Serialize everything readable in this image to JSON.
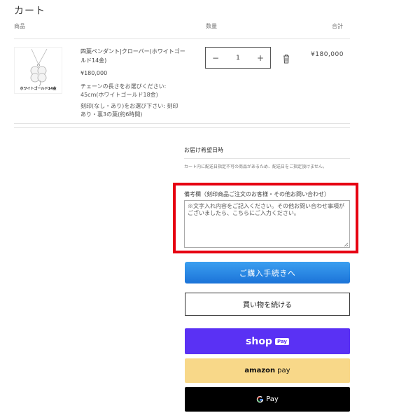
{
  "cart": {
    "title": "カート",
    "columns": {
      "product": "商品",
      "quantity": "数量",
      "total": "合計"
    },
    "item": {
      "thumb_caption": "ホワイトゴールド14金",
      "name": "四葉ペンダント|クローバー(ホワイトゴールド14金)",
      "price": "¥180,000",
      "option1": "チェーンの長さをお選びください: 45cm(ホワイトゴールド18金)",
      "option2": "刻印(なし・あり)をお選び下さい: 刻印あり・裏3の葉(約6時間)",
      "quantity": "1",
      "minus": "−",
      "plus": "+",
      "line_total": "¥180,000"
    }
  },
  "delivery": {
    "label": "お届け希望日時",
    "note": "カート内に配送日指定不可の商品があるため、配送日をご指定頂けません。"
  },
  "memo": {
    "label": "備考欄（刻印商品ご注文のお客様・その他お問い合わせ）",
    "value": "※文字入れ内容をご記入ください。その他お問い合わせ事項がございましたら、こちらにご入力ください。"
  },
  "buttons": {
    "checkout": "ご購入手続きへ",
    "continue": "買い物を続ける",
    "shop_pay": {
      "word": "shop",
      "badge": "Pay"
    },
    "amazon_pay": {
      "word": "amazon",
      "suffix": "pay"
    },
    "google_pay": {
      "suffix": "Pay"
    }
  },
  "colors": {
    "highlight": "#e60012",
    "checkout": "#2b86e5",
    "shop_pay": "#5a31f4",
    "amazon_pay": "#f8d889",
    "google_pay": "#000000"
  },
  "icons": [
    "trash-icon",
    "clover-pendant-image",
    "google-g-icon",
    "resize-grip-icon"
  ]
}
